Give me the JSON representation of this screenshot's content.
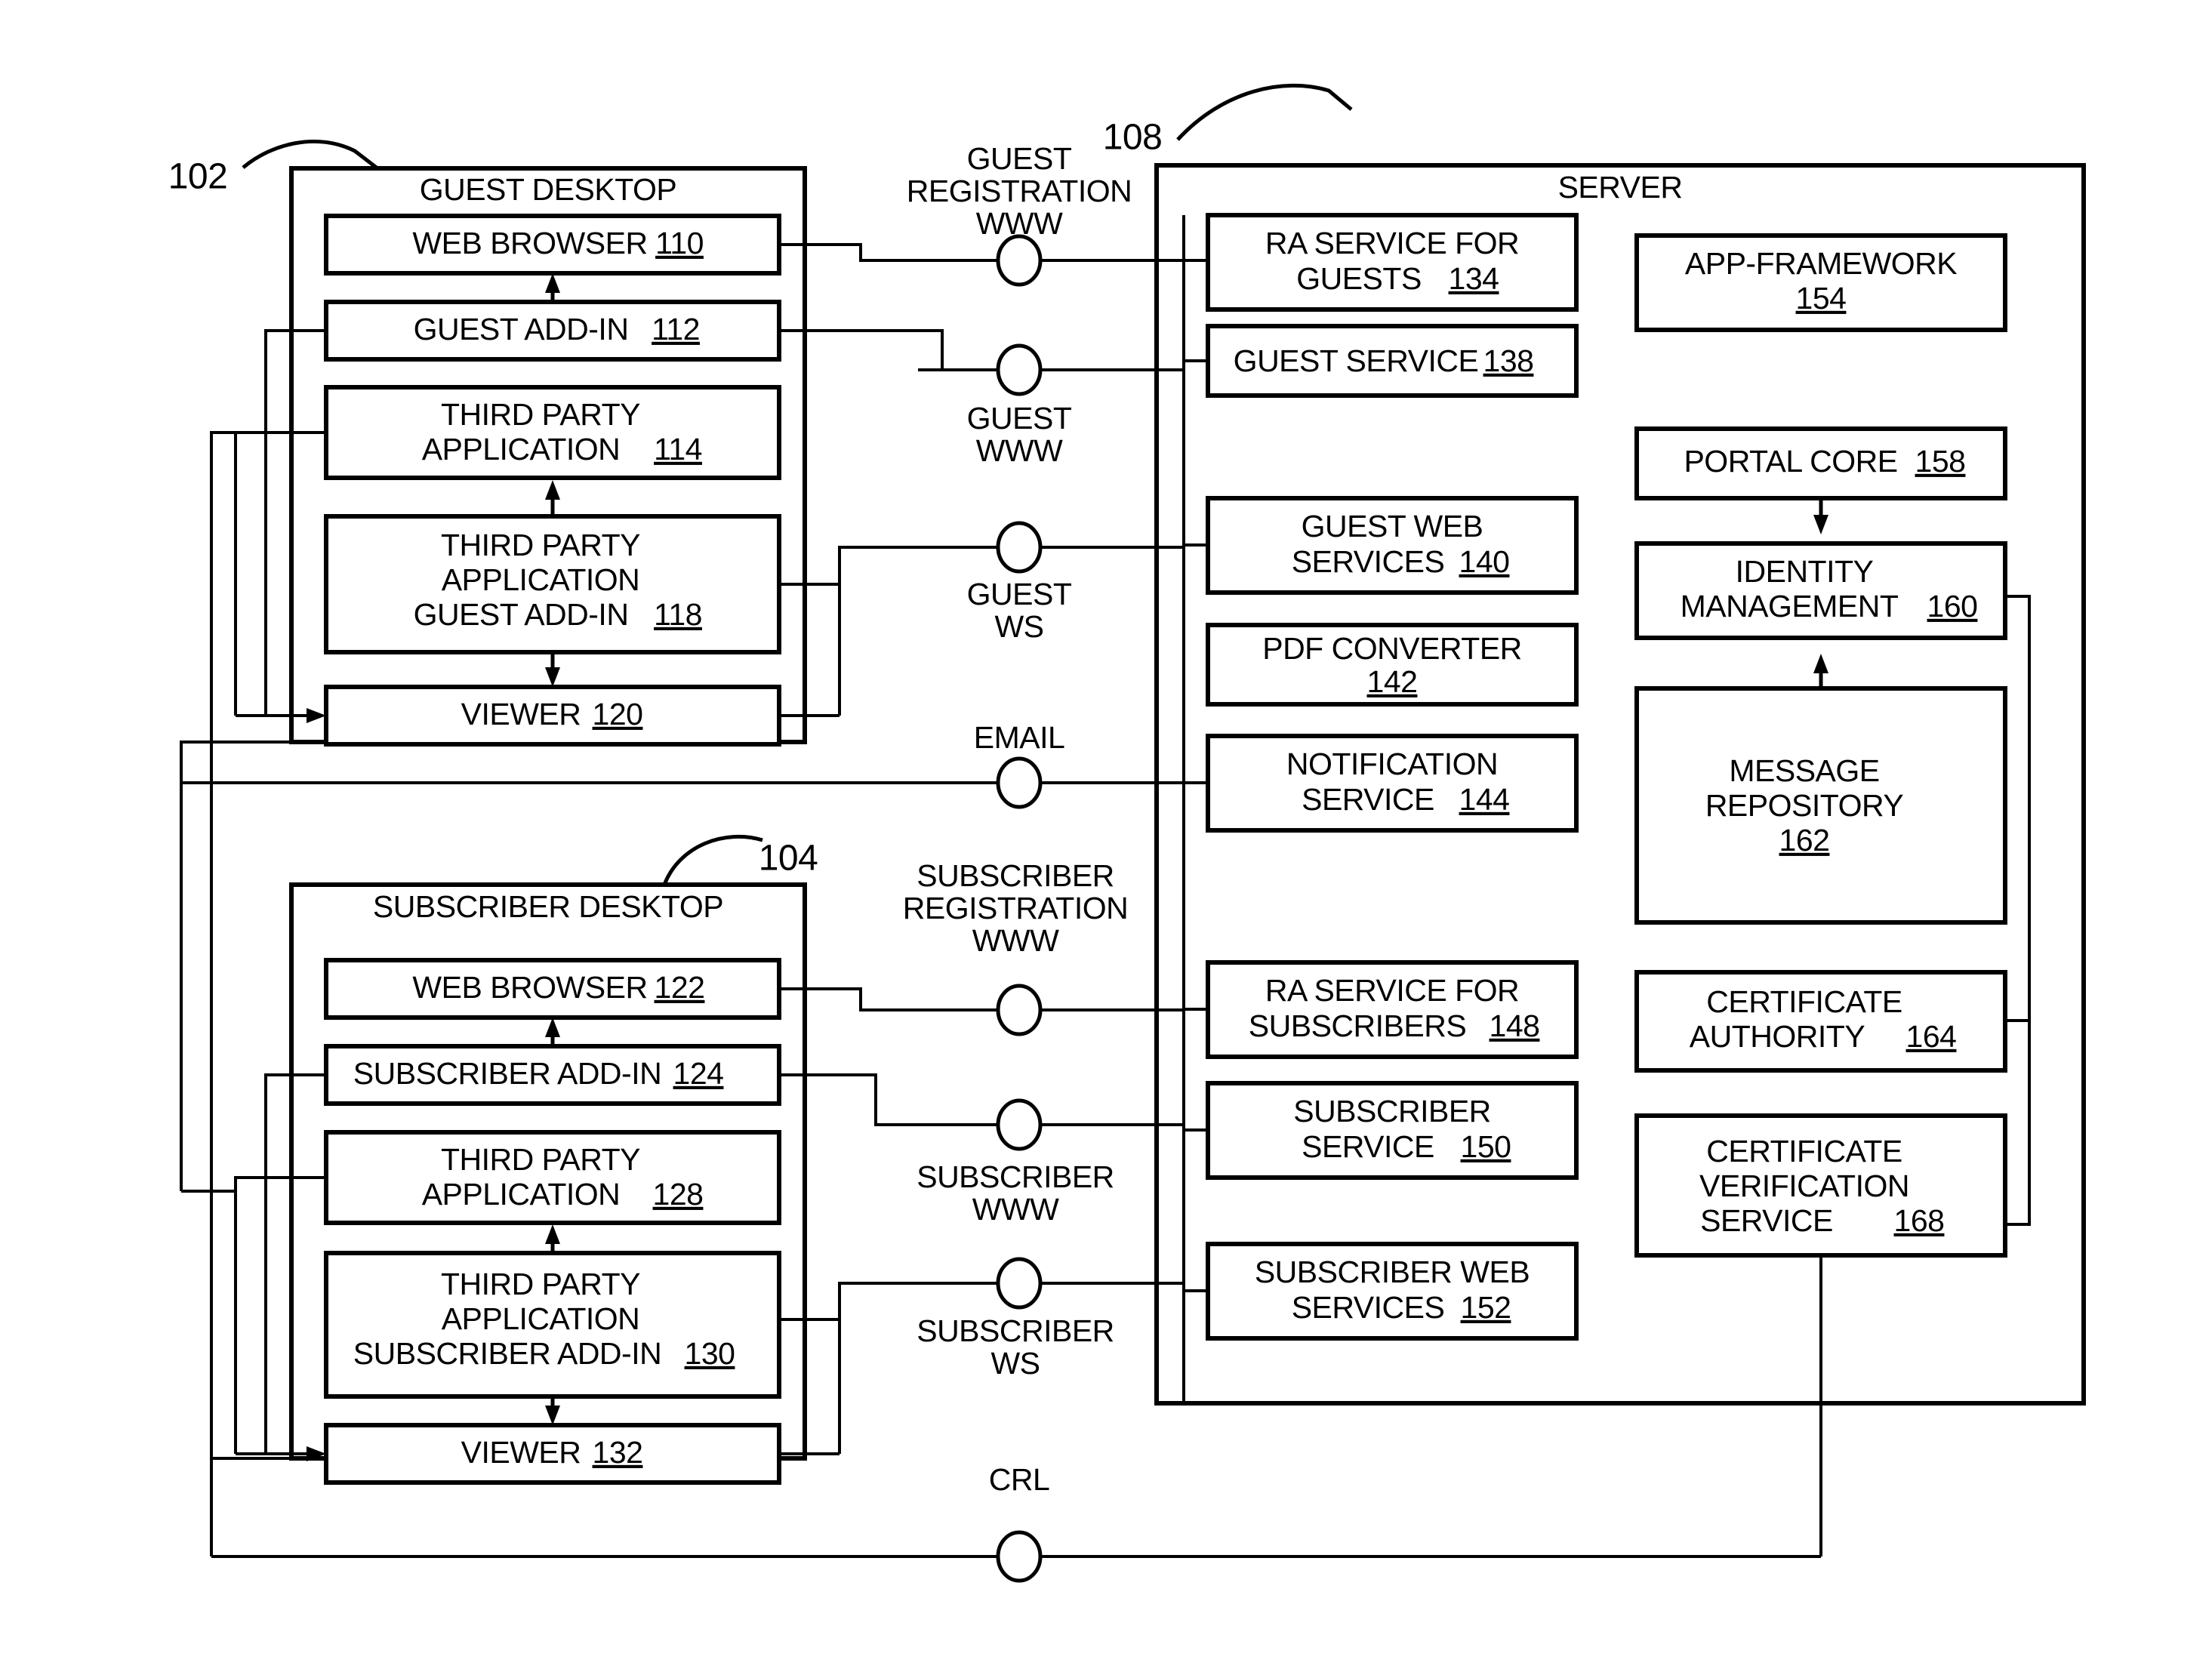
{
  "figure": {
    "reference_numerals": [
      {
        "id": "ref-102",
        "text": "102"
      },
      {
        "id": "ref-104",
        "text": "104"
      },
      {
        "id": "ref-108",
        "text": "108"
      }
    ]
  },
  "guest_desktop": {
    "title": "GUEST DESKTOP",
    "ref": "102",
    "boxes": [
      {
        "lines": [
          "WEB BROWSER"
        ],
        "num": "110"
      },
      {
        "lines": [
          "GUEST ADD-IN"
        ],
        "num": "112"
      },
      {
        "lines": [
          "THIRD PARTY",
          "APPLICATION"
        ],
        "num": "114"
      },
      {
        "lines": [
          "THIRD PARTY",
          "APPLICATION",
          "GUEST ADD-IN"
        ],
        "num": "118"
      },
      {
        "lines": [
          "VIEWER"
        ],
        "num": "120"
      }
    ]
  },
  "subscriber_desktop": {
    "title": "SUBSCRIBER DESKTOP",
    "ref": "104",
    "boxes": [
      {
        "lines": [
          "WEB BROWSER"
        ],
        "num": "122"
      },
      {
        "lines": [
          "SUBSCRIBER ADD-IN"
        ],
        "num": "124"
      },
      {
        "lines": [
          "THIRD PARTY",
          "APPLICATION"
        ],
        "num": "128"
      },
      {
        "lines": [
          "THIRD PARTY",
          "APPLICATION",
          "SUBSCRIBER ADD-IN"
        ],
        "num": "130"
      },
      {
        "lines": [
          "VIEWER"
        ],
        "num": "132"
      }
    ]
  },
  "server": {
    "title": "SERVER",
    "ref": "108",
    "left_column": [
      {
        "lines": [
          "RA SERVICE FOR",
          "GUESTS"
        ],
        "num": "134"
      },
      {
        "lines": [
          "GUEST SERVICE"
        ],
        "num": "138"
      },
      {
        "lines": [
          "GUEST WEB",
          "SERVICES"
        ],
        "num": "140"
      },
      {
        "lines": [
          "PDF CONVERTER"
        ],
        "num": "142"
      },
      {
        "lines": [
          "NOTIFICATION",
          "SERVICE"
        ],
        "num": "144"
      },
      {
        "lines": [
          "RA SERVICE FOR",
          "SUBSCRIBERS"
        ],
        "num": "148"
      },
      {
        "lines": [
          "SUBSCRIBER",
          "SERVICE"
        ],
        "num": "150"
      },
      {
        "lines": [
          "SUBSCRIBER WEB",
          "SERVICES"
        ],
        "num": "152"
      }
    ],
    "right_column": [
      {
        "lines": [
          "APP-FRAMEWORK"
        ],
        "num": "154"
      },
      {
        "lines": [
          "PORTAL CORE"
        ],
        "num": "158"
      },
      {
        "lines": [
          "IDENTITY",
          "MANAGEMENT"
        ],
        "num": "160"
      },
      {
        "lines": [
          "MESSAGE",
          "REPOSITORY"
        ],
        "num": "162"
      },
      {
        "lines": [
          "CERTIFICATE",
          "AUTHORITY"
        ],
        "num": "164"
      },
      {
        "lines": [
          "CERTIFICATE",
          "VERIFICATION",
          "SERVICE"
        ],
        "num": "168"
      }
    ]
  },
  "connections": [
    {
      "id": "conn-guest-registration-www",
      "lines": [
        "GUEST",
        "REGISTRATION",
        "WWW"
      ]
    },
    {
      "id": "conn-guest-www",
      "lines": [
        "GUEST",
        "WWW"
      ]
    },
    {
      "id": "conn-guest-ws",
      "lines": [
        "GUEST",
        "WS"
      ]
    },
    {
      "id": "conn-email",
      "lines": [
        "EMAIL"
      ]
    },
    {
      "id": "conn-subscriber-registration-www",
      "lines": [
        "SUBSCRIBER",
        "REGISTRATION",
        "WWW"
      ]
    },
    {
      "id": "conn-subscriber-www",
      "lines": [
        "SUBSCRIBER",
        "WWW"
      ]
    },
    {
      "id": "conn-subscriber-ws",
      "lines": [
        "SUBSCRIBER",
        "WS"
      ]
    },
    {
      "id": "conn-crl",
      "lines": [
        "CRL"
      ]
    }
  ],
  "colors": {
    "line": "#000000",
    "background": "#ffffff",
    "text": "#000000"
  }
}
